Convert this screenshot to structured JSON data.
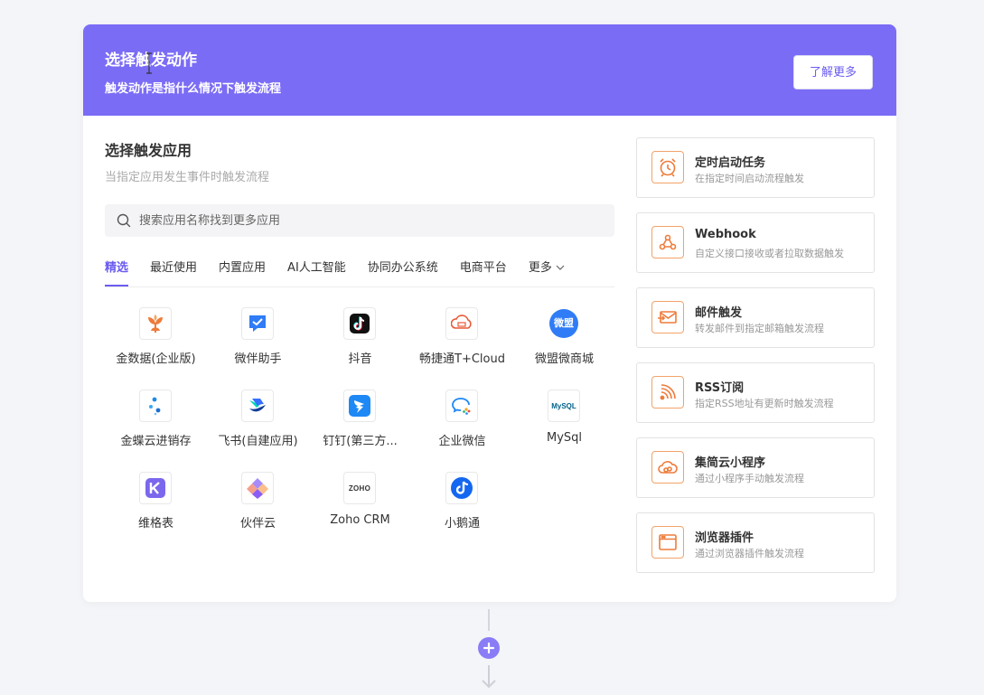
{
  "header": {
    "title": "选择触发动作",
    "subtitle": "触发动作是指什么情况下触发流程",
    "learn_more": "了解更多"
  },
  "app_section": {
    "title": "选择触发应用",
    "subtitle": "当指定应用发生事件时触发流程",
    "search_placeholder": "搜索应用名称找到更多应用"
  },
  "tabs": [
    {
      "label": "精选",
      "active": true
    },
    {
      "label": "最近使用"
    },
    {
      "label": "内置应用"
    },
    {
      "label": "AI人工智能"
    },
    {
      "label": "协同办公系统"
    },
    {
      "label": "电商平台"
    },
    {
      "label": "更多"
    }
  ],
  "apps": [
    {
      "name": "金数据(企业版)",
      "icon": "jinshuju-icon"
    },
    {
      "name": "微伴助手",
      "icon": "weiban-icon"
    },
    {
      "name": "抖音",
      "icon": "douyin-icon"
    },
    {
      "name": "畅捷通T+Cloud",
      "icon": "chanjet-icon"
    },
    {
      "name": "微盟微商城",
      "icon": "weimob-icon",
      "icon_text": "微盟"
    },
    {
      "name": "金蝶云进销存",
      "icon": "kingdee-icon"
    },
    {
      "name": "飞书(自建应用)",
      "icon": "feishu-icon"
    },
    {
      "name": "钉钉(第三方...",
      "icon": "dingtalk-icon"
    },
    {
      "name": "企业微信",
      "icon": "wecom-icon"
    },
    {
      "name": "MySql",
      "icon": "mysql-icon",
      "icon_text": "MySQL"
    },
    {
      "name": "维格表",
      "icon": "vika-icon"
    },
    {
      "name": "伙伴云",
      "icon": "huoban-icon"
    },
    {
      "name": "Zoho CRM",
      "icon": "zoho-icon",
      "icon_text": "ZOHO"
    },
    {
      "name": "小鹅通",
      "icon": "xiaoetong-icon"
    }
  ],
  "triggers": [
    {
      "title": "定时启动任务",
      "desc": "在指定时间启动流程触发",
      "icon": "alarm-clock-icon"
    },
    {
      "title": "Webhook",
      "desc": "自定义接口接收或者拉取数据触发",
      "icon": "webhook-icon"
    },
    {
      "title": "邮件触发",
      "desc": "转发邮件到指定邮箱触发流程",
      "icon": "mail-icon"
    },
    {
      "title": "RSS订阅",
      "desc": "指定RSS地址有更新时触发流程",
      "icon": "rss-icon"
    },
    {
      "title": "集简云小程序",
      "desc": "通过小程序手动触发流程",
      "icon": "cloud-icon"
    },
    {
      "title": "浏览器插件",
      "desc": "通过浏览器插件触发流程",
      "icon": "browser-icon"
    }
  ],
  "colors": {
    "brand": "#7b6cf6",
    "accent": "#6b5cf0",
    "trigger_icon": "#ee7b3a"
  }
}
